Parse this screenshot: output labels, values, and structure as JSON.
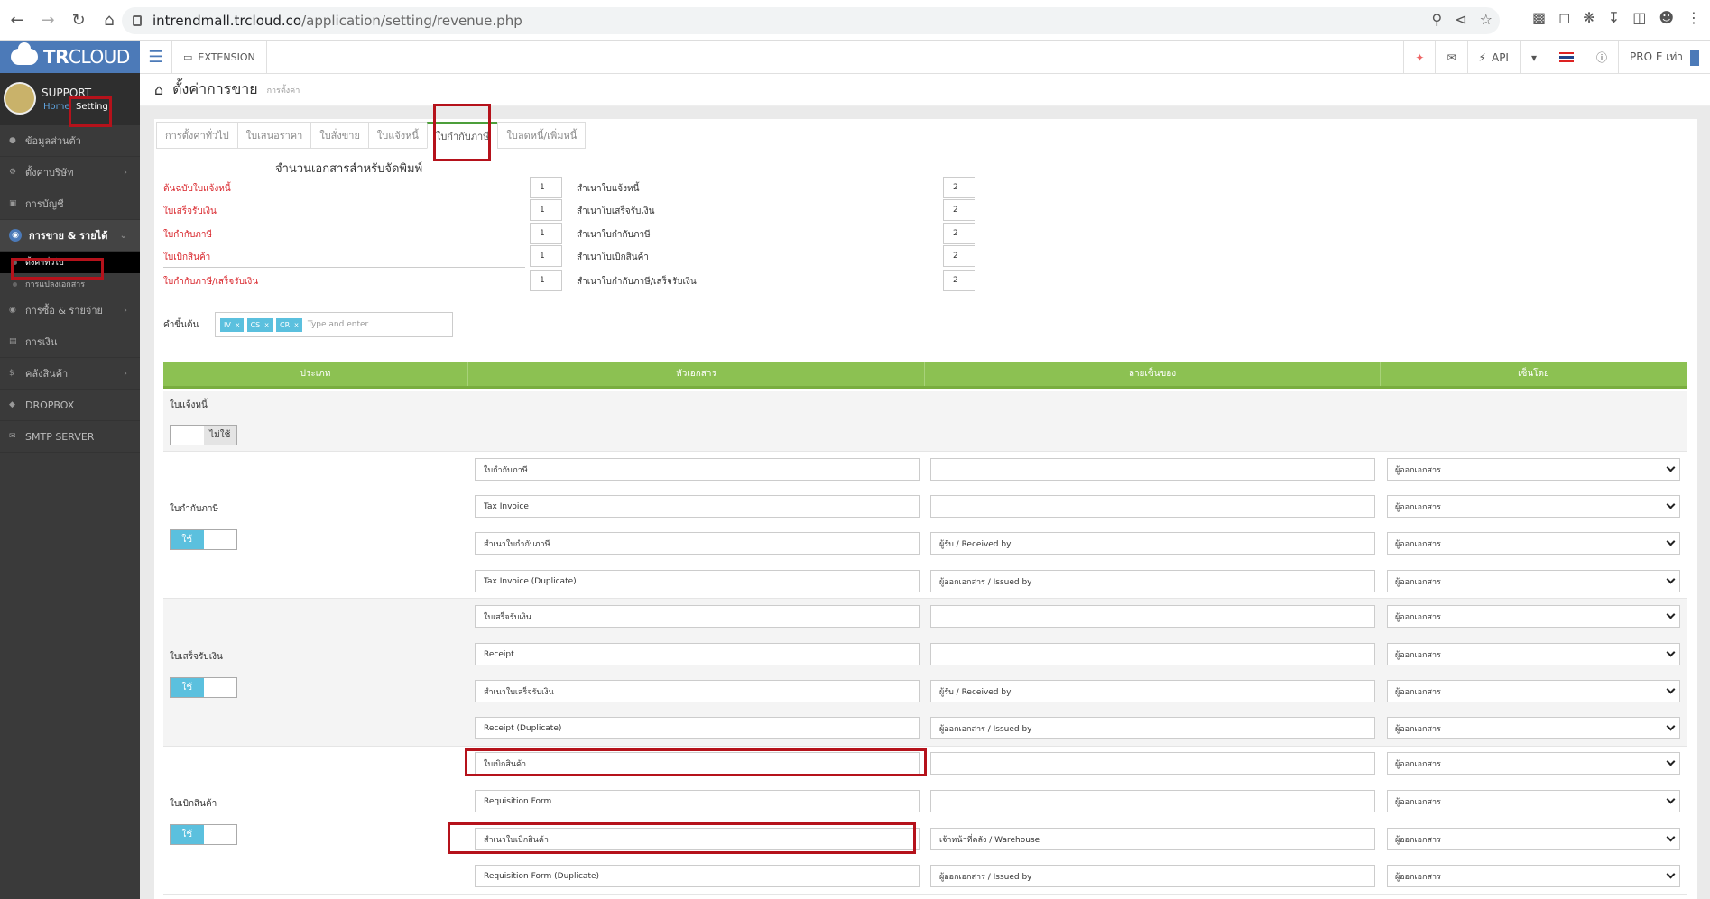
{
  "browser": {
    "url_host": "intrendmall.trcloud.co",
    "url_path": "/application/setting/revenue.php"
  },
  "sidebar": {
    "brand_tr": "TR",
    "brand_cloud": "CLOUD",
    "profile_name": "SUPPORT",
    "home_link": "Home",
    "setting_link": "Setting",
    "items": [
      {
        "label": "ข้อมูลส่วนตัว",
        "icon": "user-icon"
      },
      {
        "label": "ตั้งค่าบริษัท",
        "icon": "gear-icon"
      },
      {
        "label": "การบัญชี",
        "icon": "book-icon"
      },
      {
        "label": "การขาย & รายได้",
        "icon": "cart-icon"
      },
      {
        "label": "การซื้อ & รายจ่าย",
        "icon": "cart-icon"
      },
      {
        "label": "การเงิน",
        "icon": "wallet-icon"
      },
      {
        "label": "คลังสินค้า",
        "icon": "dollar-icon"
      },
      {
        "label": "DROPBOX",
        "icon": "dropbox-icon"
      },
      {
        "label": "SMTP SERVER",
        "icon": "mail-icon"
      }
    ],
    "subitems": [
      {
        "label": "ตั้งค่าทั่วไป"
      },
      {
        "label": "การแปลงเอกสาร"
      }
    ]
  },
  "topbar": {
    "extension": "EXTENSION",
    "api": "API",
    "user": "PRO E เท่า"
  },
  "page": {
    "title": "ตั้งค่าการขาย",
    "subtitle": "การตั้งค่า"
  },
  "tabs": [
    {
      "label": "การตั้งค่าทั่วไป"
    },
    {
      "label": "ใบเสนอราคา"
    },
    {
      "label": "ใบสั่งขาย"
    },
    {
      "label": "ใบแจ้งหนี้"
    },
    {
      "label": "ใบกำกับภาษี"
    },
    {
      "label": "ใบลดหนี้/เพิ่มหนี้"
    }
  ],
  "print_counts": {
    "title": "จำนวนเอกสารสำหรับจัดพิมพ์",
    "rows": [
      {
        "label": "ต้นฉบับใบแจ้งหนี้",
        "value": "1",
        "copy_label": "สำเนาใบแจ้งหนี้",
        "copy_value": "2"
      },
      {
        "label": "ใบเสร็จรับเงิน",
        "value": "1",
        "copy_label": "สำเนาใบเสร็จรับเงิน",
        "copy_value": "2"
      },
      {
        "label": "ใบกำกับภาษี",
        "value": "1",
        "copy_label": "สำเนาใบกำกับภาษี",
        "copy_value": "2"
      },
      {
        "label": "ใบเบิกสินค้า",
        "value": "1",
        "copy_label": "สำเนาใบเบิกสินค้า",
        "copy_value": "2"
      },
      {
        "label": "ใบกำกับภาษี/เสร็จรับเงิน",
        "value": "1",
        "copy_label": "สำเนาใบกำกับภาษี/เสร็จรับเงิน",
        "copy_value": "2"
      }
    ]
  },
  "prefix": {
    "label": "คำขึ้นต้น",
    "chips": [
      "IV",
      "CS",
      "CR"
    ],
    "chip_x": "x",
    "placeholder": "Type and enter"
  },
  "table": {
    "headers": [
      "ประเภท",
      "หัวเอกสาร",
      "ลายเซ็นของ",
      "เซ็นโดย"
    ],
    "groups": [
      {
        "name": "ใบแจ้งหนี้",
        "toggle": "ไม่ใช้",
        "rows": []
      },
      {
        "name": "ใบกำกับภาษี",
        "toggle": "ใช้",
        "rows": [
          {
            "title": "ใบกำกับภาษี",
            "signer": "",
            "signed_by": "ผู้ออกเอกสาร"
          },
          {
            "title": "Tax Invoice",
            "signer": "",
            "signed_by": "ผู้ออกเอกสาร"
          },
          {
            "title": "สำเนาใบกำกับภาษี",
            "signer": "ผู้รับ / Received by",
            "signed_by": "ผู้ออกเอกสาร"
          },
          {
            "title": "Tax Invoice (Duplicate)",
            "signer": "ผู้ออกเอกสาร / Issued by",
            "signed_by": "ผู้ออกเอกสาร"
          }
        ]
      },
      {
        "name": "ใบเสร็จรับเงิน",
        "toggle": "ใช้",
        "rows": [
          {
            "title": "ใบเสร็จรับเงิน",
            "signer": "",
            "signed_by": "ผู้ออกเอกสาร"
          },
          {
            "title": "Receipt",
            "signer": "",
            "signed_by": "ผู้ออกเอกสาร"
          },
          {
            "title": "สำเนาใบเสร็จรับเงิน",
            "signer": "ผู้รับ / Received by",
            "signed_by": "ผู้ออกเอกสาร"
          },
          {
            "title": "Receipt (Duplicate)",
            "signer": "ผู้ออกเอกสาร / Issued by",
            "signed_by": "ผู้ออกเอกสาร"
          }
        ]
      },
      {
        "name": "ใบเบิกสินค้า",
        "toggle": "ใช้",
        "rows": [
          {
            "title": "ใบเบิกสินค้า",
            "signer": "",
            "signed_by": "ผู้ออกเอกสาร"
          },
          {
            "title": "Requisition Form",
            "signer": "",
            "signed_by": "ผู้ออกเอกสาร"
          },
          {
            "title": "สำเนาใบเบิกสินค้า",
            "signer": "เจ้าหน้าที่คลัง / Warehouse",
            "signed_by": "ผู้ออกเอกสาร"
          },
          {
            "title": "Requisition Form (Duplicate)",
            "signer": "ผู้ออกเอกสาร / Issued by",
            "signed_by": "ผู้ออกเอกสาร"
          }
        ]
      }
    ]
  },
  "colors": {
    "brand": "#4c7ab8",
    "table_header": "#8cc152",
    "toggle_on": "#5bc0de",
    "highlight": "#b5121b",
    "required_label": "#d9252b"
  }
}
